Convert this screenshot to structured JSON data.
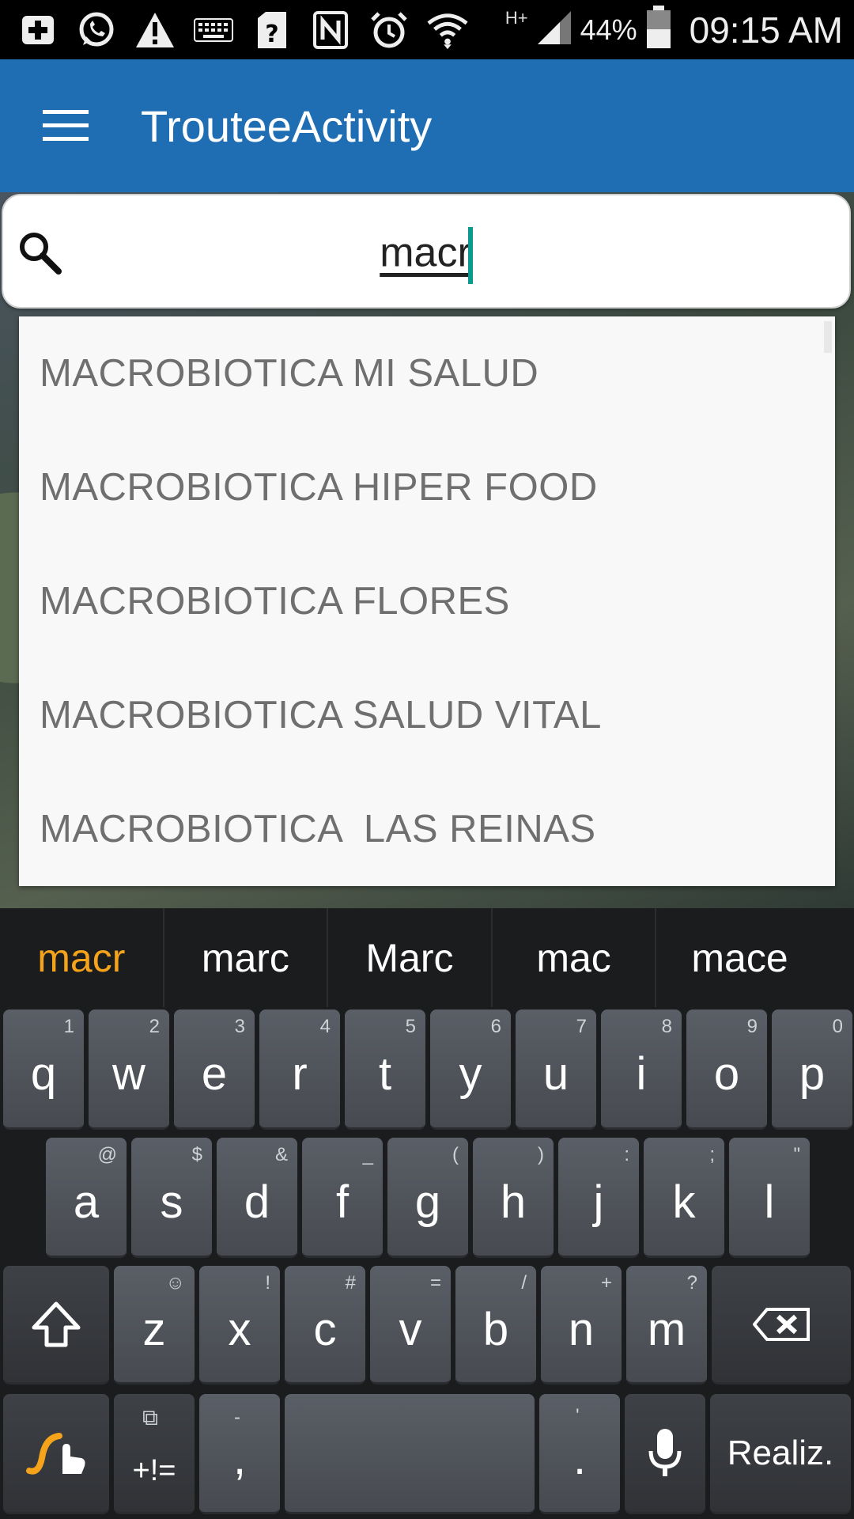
{
  "status_bar": {
    "icons": [
      "add-icon",
      "whatsapp-icon",
      "warning-icon",
      "keyboard-icon",
      "sim-question-icon",
      "nfc-icon",
      "alarm-icon",
      "wifi-icon",
      "hplus-icon",
      "signal-icon"
    ],
    "network_label": "H+",
    "battery_percent": "44%",
    "time": "09:15 AM"
  },
  "app_bar": {
    "title": "TrouteeActivity"
  },
  "search": {
    "value": "macr"
  },
  "suggestions": [
    "MACROBIOTICA MI SALUD",
    "MACROBIOTICA HIPER FOOD",
    "MACROBIOTICA FLORES",
    "MACROBIOTICA SALUD VITAL",
    "MACROBIOTICA  LAS REINAS"
  ],
  "keyboard": {
    "predictions": [
      "macr",
      "marc",
      "Marc",
      "mac",
      "mace"
    ],
    "row1": [
      {
        "k": "q",
        "a": "1"
      },
      {
        "k": "w",
        "a": "2"
      },
      {
        "k": "e",
        "a": "3"
      },
      {
        "k": "r",
        "a": "4"
      },
      {
        "k": "t",
        "a": "5"
      },
      {
        "k": "y",
        "a": "6"
      },
      {
        "k": "u",
        "a": "7"
      },
      {
        "k": "i",
        "a": "8"
      },
      {
        "k": "o",
        "a": "9"
      },
      {
        "k": "p",
        "a": "0"
      }
    ],
    "row2": [
      {
        "k": "a",
        "a": "@"
      },
      {
        "k": "s",
        "a": "$"
      },
      {
        "k": "d",
        "a": "&"
      },
      {
        "k": "f",
        "a": "_"
      },
      {
        "k": "g",
        "a": "("
      },
      {
        "k": "h",
        "a": ")"
      },
      {
        "k": "j",
        "a": ":"
      },
      {
        "k": "k",
        "a": ";"
      },
      {
        "k": "l",
        "a": "\""
      }
    ],
    "row3": [
      {
        "k": "z",
        "a": "☺"
      },
      {
        "k": "x",
        "a": "!"
      },
      {
        "k": "c",
        "a": "#"
      },
      {
        "k": "v",
        "a": "="
      },
      {
        "k": "b",
        "a": "/"
      },
      {
        "k": "n",
        "a": "+"
      },
      {
        "k": "m",
        "a": "?"
      }
    ],
    "symbols_label": "+!=",
    "comma": ",",
    "comma_alt": "-",
    "period": ".",
    "period_alt": "'",
    "done_label": "Realiz.",
    "accent_color": "#f5a31a"
  }
}
